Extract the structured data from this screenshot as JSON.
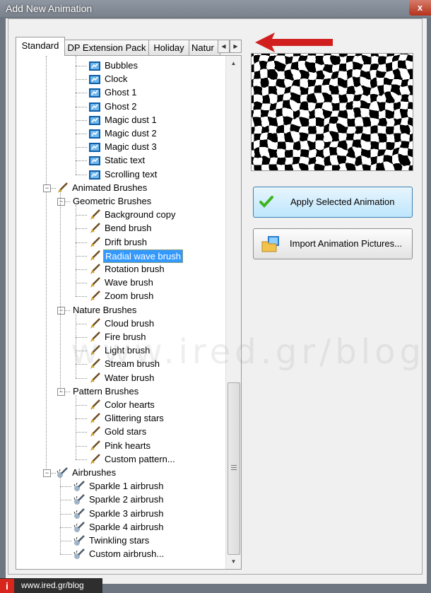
{
  "window": {
    "title": "Add New Animation",
    "close_label": "x"
  },
  "tabs": [
    {
      "label": "Standard",
      "active": true
    },
    {
      "label": "DP Extension Pack",
      "active": false
    },
    {
      "label": "Holiday",
      "active": false
    },
    {
      "label": "Natur",
      "active": false
    }
  ],
  "tab_scroll": {
    "left": "◀",
    "right": "▶"
  },
  "tree": {
    "film_items": [
      "Bubbles",
      "Clock",
      "Ghost 1",
      "Ghost 2",
      "Magic dust 1",
      "Magic dust 2",
      "Magic dust 3",
      "Static text",
      "Scrolling text"
    ],
    "animated_brushes": {
      "label": "Animated Brushes",
      "geometric": {
        "label": "Geometric Brushes",
        "items": [
          "Background copy",
          "Bend brush",
          "Drift brush",
          "Radial wave brush",
          "Rotation brush",
          "Wave brush",
          "Zoom brush"
        ]
      },
      "nature": {
        "label": "Nature Brushes",
        "items": [
          "Cloud brush",
          "Fire brush",
          "Light brush",
          "Stream brush",
          "Water brush"
        ]
      },
      "pattern": {
        "label": "Pattern Brushes",
        "items": [
          "Color hearts",
          "Glittering stars",
          "Gold stars",
          "Pink hearts",
          "Custom pattern..."
        ]
      }
    },
    "airbrushes": {
      "label": "Airbrushes",
      "items": [
        "Sparkle 1 airbrush",
        "Sparkle 2 airbrush",
        "Sparkle 3 airbrush",
        "Sparkle 4 airbrush",
        "Twinkling stars",
        "Custom airbrush..."
      ]
    },
    "selected": "Radial wave brush",
    "expander_minus": "−"
  },
  "scroll": {
    "up": "▲",
    "down": "▼"
  },
  "buttons": {
    "apply": "Apply Selected Animation",
    "import": "Import Animation Pictures..."
  },
  "watermark": "www.ired.gr/blog",
  "footer": {
    "logo": "i",
    "url": "www.ired.gr/blog"
  },
  "colors": {
    "selection": "#3399ff",
    "arrow": "#d11f1f",
    "apply_check": "#3cb521"
  }
}
